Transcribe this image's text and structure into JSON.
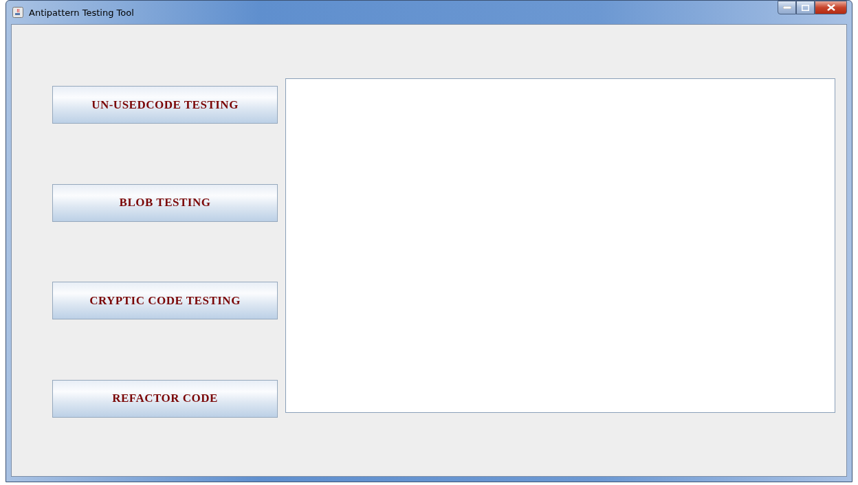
{
  "window": {
    "title": "Antipattern Testing Tool"
  },
  "buttons": [
    {
      "label": "UN-USEDCODE TESTING"
    },
    {
      "label": "BLOB TESTING"
    },
    {
      "label": "CRYPTIC CODE TESTING"
    },
    {
      "label": "REFACTOR CODE"
    }
  ]
}
